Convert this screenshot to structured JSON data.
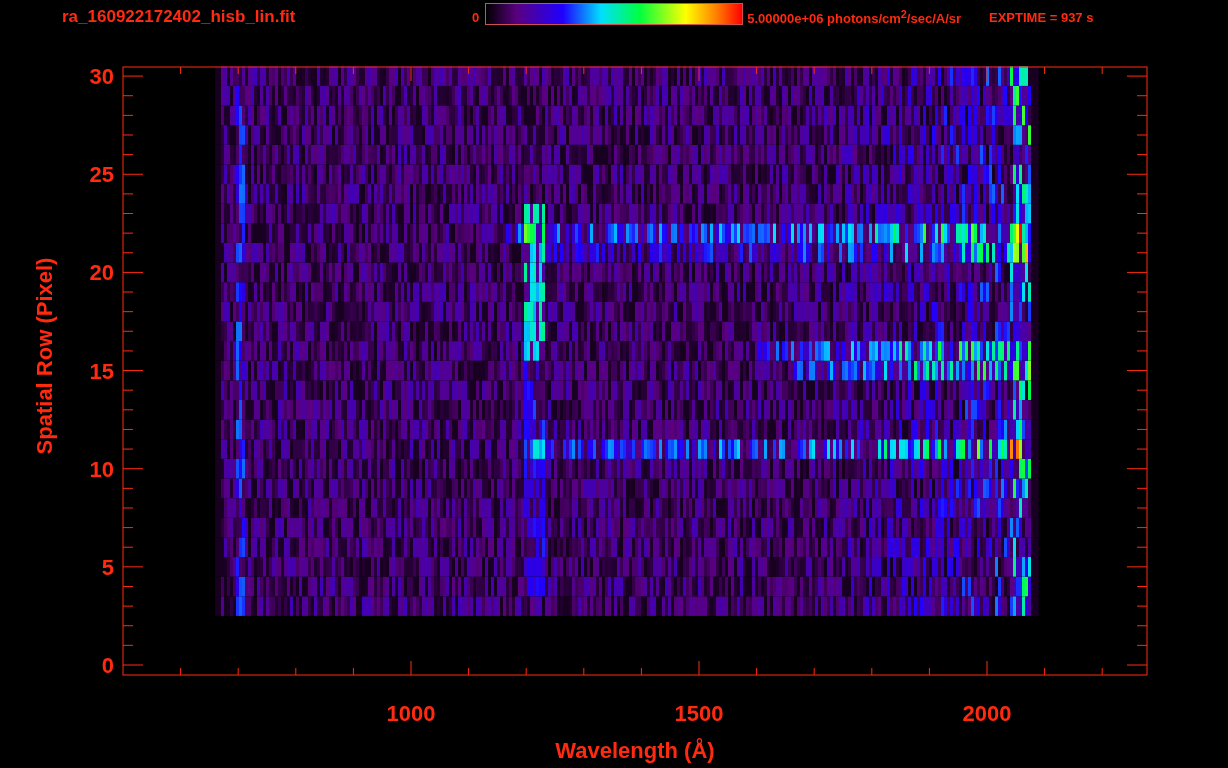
{
  "header": {
    "filename": "ra_160922172402_hisb_lin.fit",
    "colorbar_min": "0",
    "colorbar_max": "5.00000e+06 photons/cm$^{2}$/sec/A/sr",
    "exptime": "EXPTIME = 937 s"
  },
  "plot": {
    "xlabel": "Wavelength (Å)",
    "ylabel": "Spatial Row (Pixel)",
    "xticks": [
      "1000",
      "1500",
      "2000"
    ],
    "yticks": [
      "30",
      "25",
      "20",
      "15",
      "10",
      "5",
      "0"
    ]
  }
}
